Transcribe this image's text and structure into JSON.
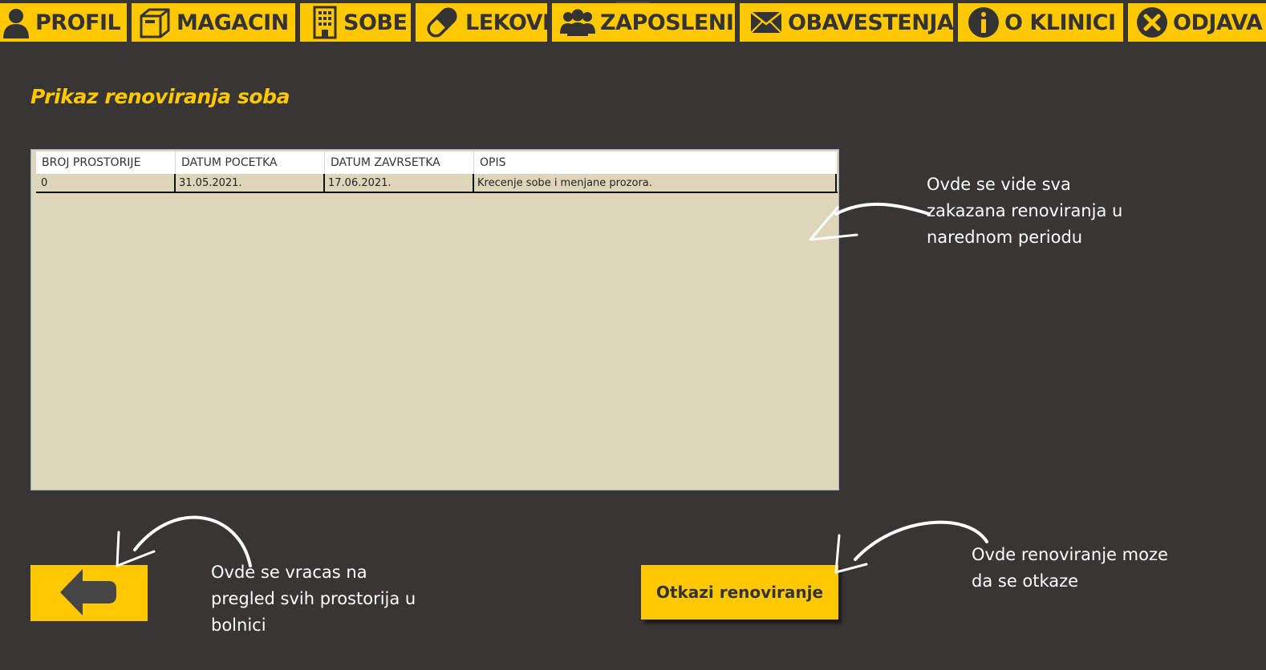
{
  "nav": {
    "items": [
      {
        "label": "PROFIL",
        "icon": "user-icon"
      },
      {
        "label": "MAGACIN",
        "icon": "box-icon"
      },
      {
        "label": "SOBE",
        "icon": "building-icon"
      },
      {
        "label": "LEKOVI",
        "icon": "pill-icon"
      },
      {
        "label": "ZAPOSLENI",
        "icon": "people-icon"
      },
      {
        "label": "OBAVESTENJA",
        "icon": "envelope-icon"
      },
      {
        "label": "O KLINICI",
        "icon": "info-icon"
      },
      {
        "label": "ODJAVA",
        "icon": "close-circle-icon"
      }
    ]
  },
  "page": {
    "title": "Prikaz renoviranja soba"
  },
  "table": {
    "columns": [
      "BROJ PROSTORIJE",
      "DATUM POCETKA",
      "DATUM ZAVRSETKA",
      "OPIS"
    ],
    "rows": [
      [
        "0",
        "31.05.2021.",
        "17.06.2021.",
        "Krecenje sobe i menjane prozora."
      ]
    ]
  },
  "annotations": {
    "table_note": [
      "Ovde se vide sva",
      "zakazana renoviranja u",
      "narednom periodu"
    ],
    "back_note": [
      "Ovde se vracas na",
      "pregled svih prostorija u",
      "bolnici"
    ],
    "cancel_note": [
      "Ovde renoviranje moze",
      "da se otkaze"
    ]
  },
  "buttons": {
    "cancel_label": "Otkazi renoviranje",
    "back_icon": "arrow-left-icon"
  },
  "colors": {
    "accent": "#ffc800",
    "background": "#383535",
    "grid": "#ded6bb",
    "text_dark": "#333333"
  }
}
